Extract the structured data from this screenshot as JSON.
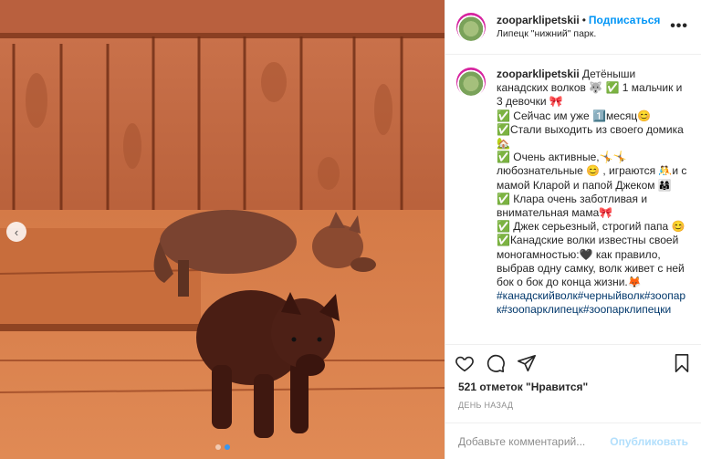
{
  "post": {
    "username": "zooparklipetskii",
    "follow_label": "Подписаться",
    "separator": "•",
    "location": "Липецк \"нижний\" парк.",
    "more_icon": "more-icon",
    "image_alt": "wolf-cubs-photo",
    "carousel": {
      "dots": 2,
      "active": 1
    }
  },
  "caption": {
    "username": "zooparklipetskii",
    "text": "Детёныши канадских волков 🐺 ✅ 1 мальчик и 3 девочки 🎀\n✅ Сейчас им уже 1️⃣месяц😊\n✅Стали выходить из своего домика 🏡\n✅ Очень активные,🤸🤸 любознательные 😊 , играются 🤼и с мамой Кларой и папой Джеком 👨‍👩‍👧\n✅ Клара очень заботливая и внимательная мама🎀\n✅ Джек серьезный, строгий папа 😊\n✅Канадские волки известны своей моногамностью:🖤 как правило, выбрав одну самку, волк живет с ней бок о бок до конца жизни.🦊",
    "hashtags": "#канадскийволк#черныйволк#зоопарк#зоопарклипецк#зоопарклипецки"
  },
  "stats": {
    "likes": "521 отметок \"Нравится\"",
    "time": "ДЕНЬ НАЗАД"
  },
  "comment": {
    "placeholder": "Добавьте комментарий...",
    "publish_label": "Опубликовать"
  },
  "colors": {
    "accent": "#0095f6",
    "publish_disabled": "#b2dffc",
    "hashtag": "#00376b"
  }
}
